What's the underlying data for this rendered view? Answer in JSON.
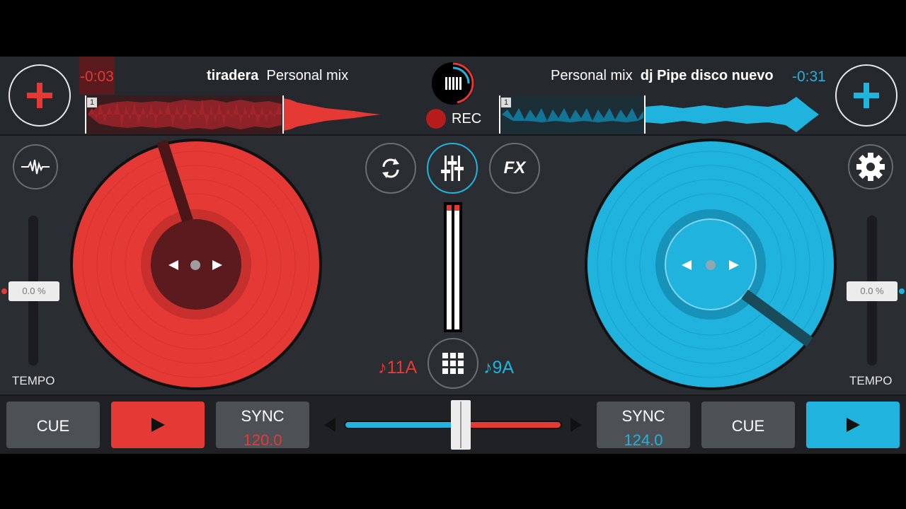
{
  "left_deck": {
    "color": "#e53935",
    "time": "-0:03",
    "title_bold": "tiradera",
    "title_rest": "Personal mix",
    "wave_marker": "1",
    "tempo_value": "0.0 %",
    "tempo_label": "TEMPO",
    "key": "♪11A",
    "cue_label": "CUE",
    "sync_label": "SYNC",
    "bpm": "120.0"
  },
  "right_deck": {
    "color": "#1fb3de",
    "time": "-0:31",
    "title_rest": "Personal mix",
    "title_bold": "dj Pipe disco nuevo",
    "wave_marker": "1",
    "tempo_value": "0.0 %",
    "tempo_label": "TEMPO",
    "key": "♪9A",
    "cue_label": "CUE",
    "sync_label": "SYNC",
    "bpm": "124.0"
  },
  "center": {
    "rec_label": "REC",
    "fx_label": "FX"
  },
  "crossfader": {
    "position": 0.5
  },
  "icons": {
    "add_left": "plus-icon",
    "add_right": "plus-icon",
    "waveform": "waveform-icon",
    "settings": "gear-icon",
    "loop": "loop-icon",
    "mixer": "sliders-icon",
    "pads": "grid-icon",
    "play": "play-icon"
  }
}
